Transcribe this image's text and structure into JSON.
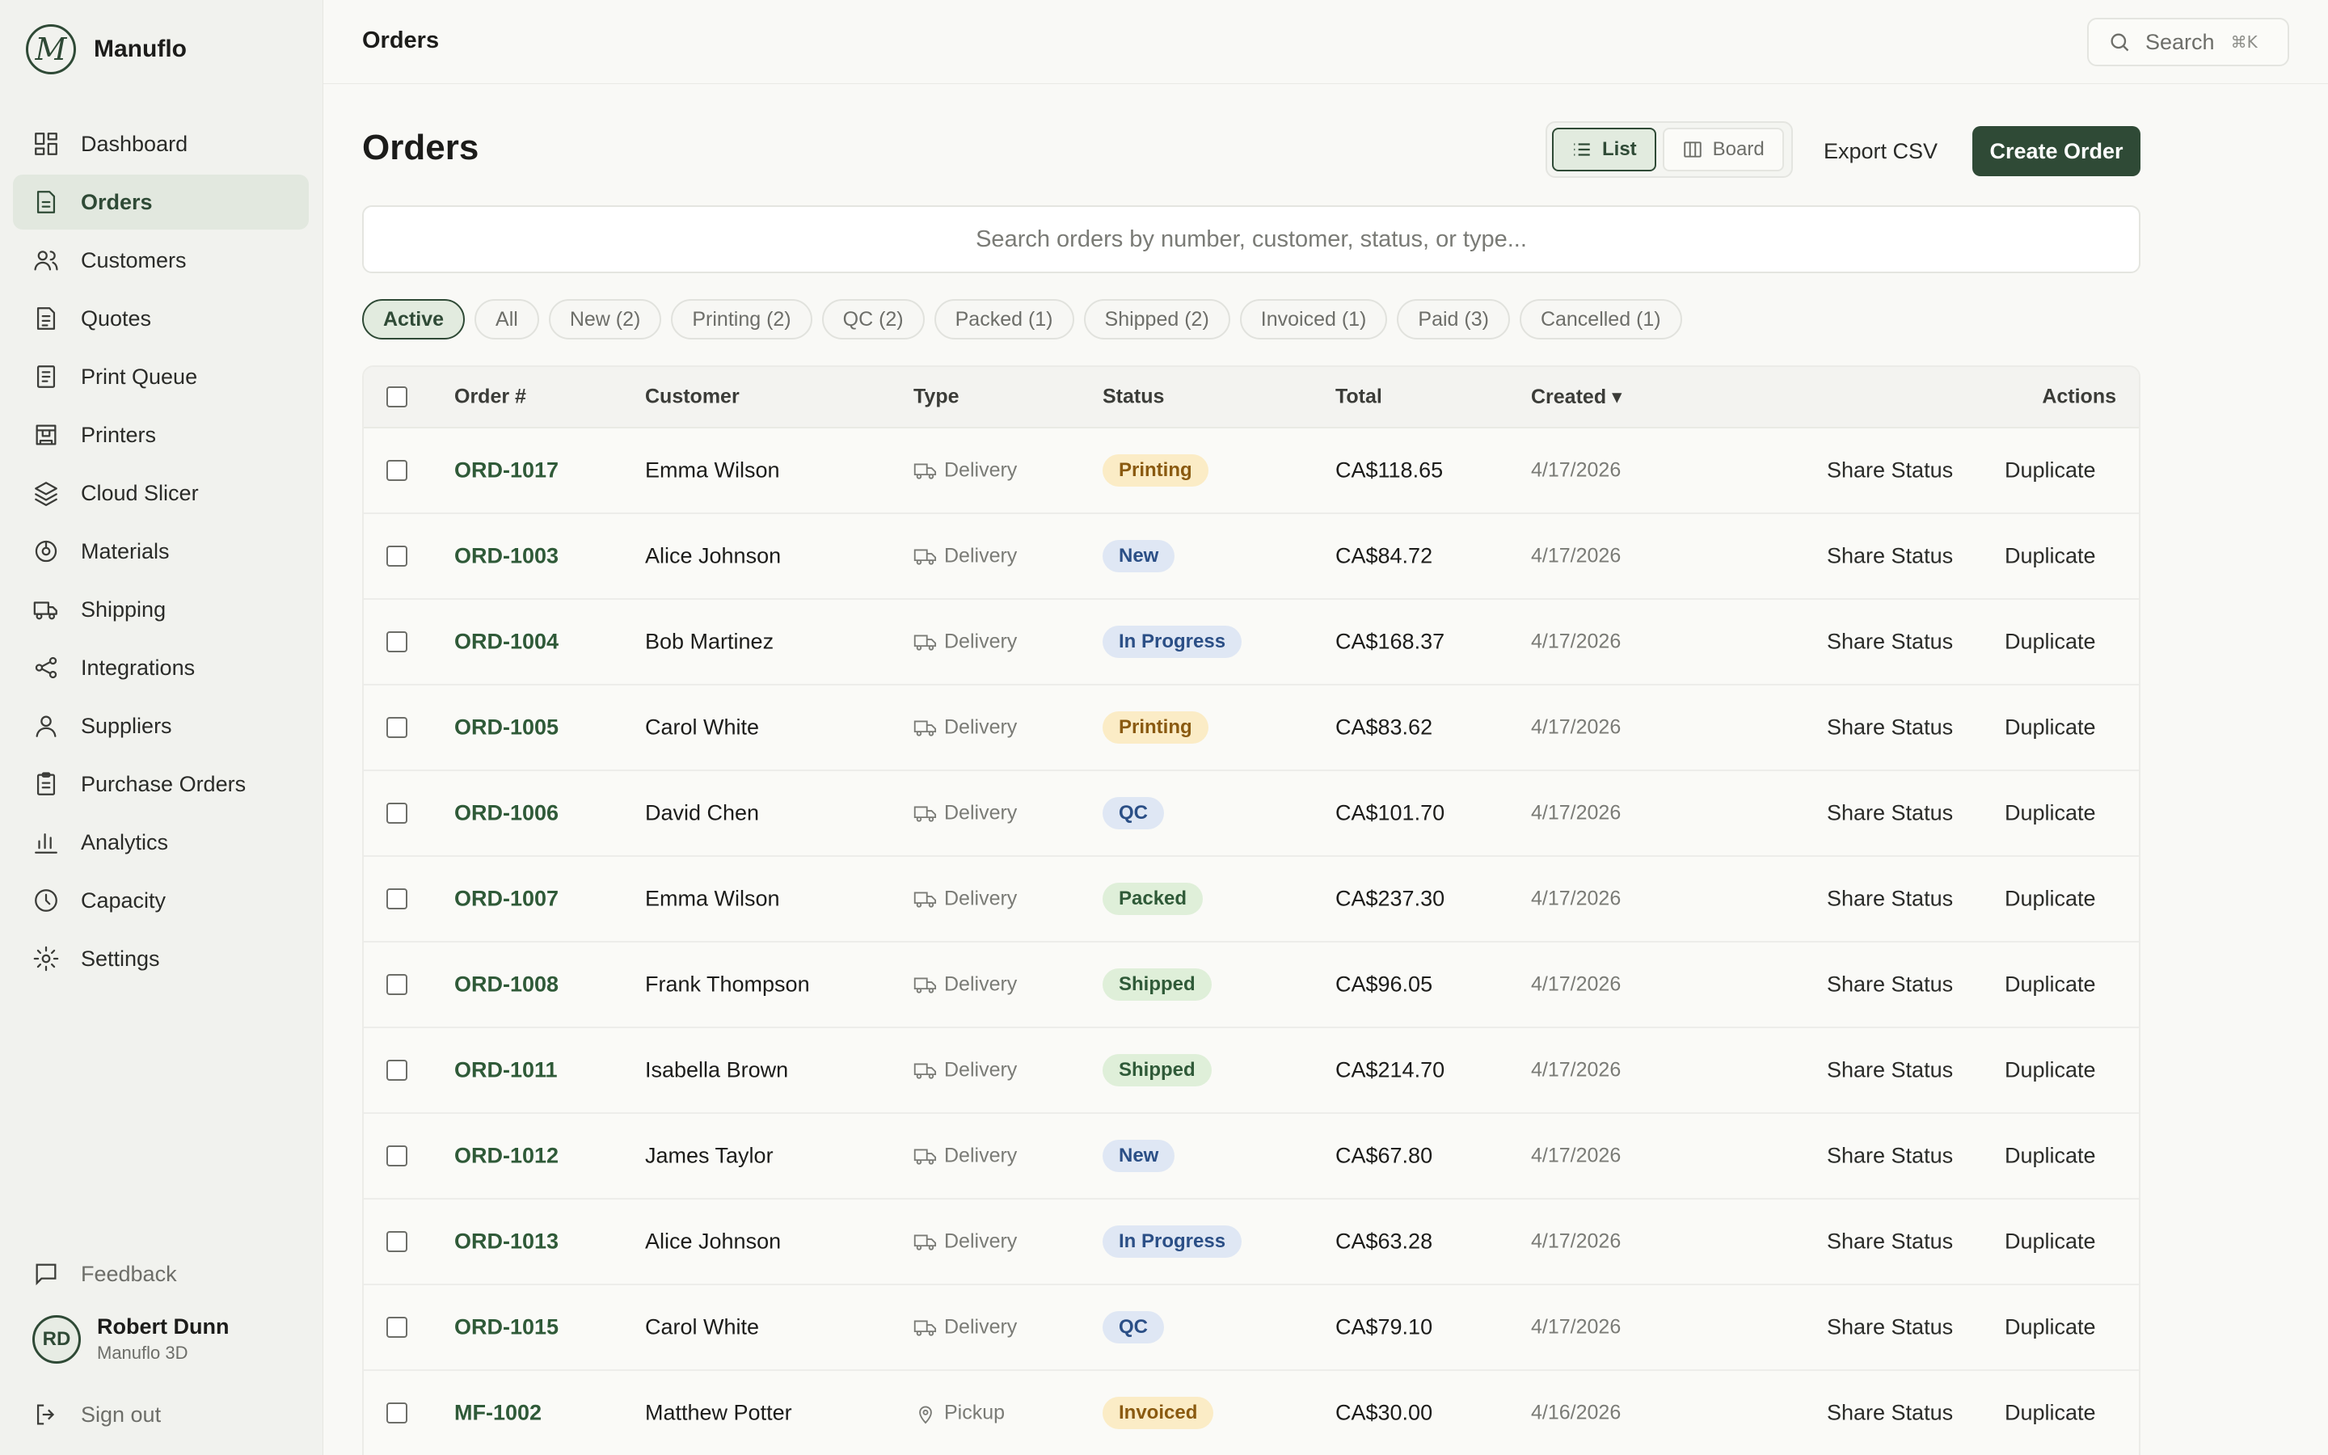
{
  "brand": {
    "logo_letter": "M",
    "name": "Manuflo"
  },
  "sidebar": {
    "items": [
      {
        "label": "Dashboard",
        "icon": "dashboard-icon",
        "active": false
      },
      {
        "label": "Orders",
        "icon": "orders-icon",
        "active": true
      },
      {
        "label": "Customers",
        "icon": "customers-icon",
        "active": false
      },
      {
        "label": "Quotes",
        "icon": "quotes-icon",
        "active": false
      },
      {
        "label": "Print Queue",
        "icon": "print-queue-icon",
        "active": false
      },
      {
        "label": "Printers",
        "icon": "printer-icon",
        "active": false
      },
      {
        "label": "Cloud Slicer",
        "icon": "layers-icon",
        "active": false
      },
      {
        "label": "Materials",
        "icon": "spool-icon",
        "active": false
      },
      {
        "label": "Shipping",
        "icon": "truck-icon",
        "active": false
      },
      {
        "label": "Integrations",
        "icon": "share-nodes-icon",
        "active": false
      },
      {
        "label": "Suppliers",
        "icon": "user-icon",
        "active": false
      },
      {
        "label": "Purchase Orders",
        "icon": "clipboard-icon",
        "active": false
      },
      {
        "label": "Analytics",
        "icon": "bar-chart-icon",
        "active": false
      },
      {
        "label": "Capacity",
        "icon": "clock-icon",
        "active": false
      },
      {
        "label": "Settings",
        "icon": "gear-icon",
        "active": false
      }
    ],
    "feedback_label": "Feedback",
    "signout_label": "Sign out",
    "user": {
      "initials": "RD",
      "name": "Robert Dunn",
      "org": "Manuflo 3D"
    }
  },
  "topbar": {
    "title": "Orders",
    "search_label": "Search",
    "search_shortcut": "⌘K"
  },
  "main": {
    "title": "Orders",
    "view_toggle": {
      "list_label": "List",
      "board_label": "Board",
      "selected": "List"
    },
    "export_label": "Export CSV",
    "create_label": "Create Order",
    "search_placeholder": "Search orders by number, customer, status, or type...",
    "filters": [
      {
        "label": "Active",
        "active": true
      },
      {
        "label": "All",
        "active": false
      },
      {
        "label": "New (2)",
        "active": false
      },
      {
        "label": "Printing (2)",
        "active": false
      },
      {
        "label": "QC (2)",
        "active": false
      },
      {
        "label": "Packed (1)",
        "active": false
      },
      {
        "label": "Shipped (2)",
        "active": false
      },
      {
        "label": "Invoiced (1)",
        "active": false
      },
      {
        "label": "Paid (3)",
        "active": false
      },
      {
        "label": "Cancelled (1)",
        "active": false
      }
    ]
  },
  "table": {
    "columns": {
      "order": "Order #",
      "customer": "Customer",
      "type": "Type",
      "status": "Status",
      "total": "Total",
      "created": "Created ▾",
      "actions": "Actions"
    },
    "action_share": "Share Status",
    "action_duplicate": "Duplicate",
    "rows": [
      {
        "order": "ORD-1017",
        "customer": "Emma Wilson",
        "type": "Delivery",
        "status": "Printing",
        "total": "CA$118.65",
        "created": "4/17/2026"
      },
      {
        "order": "ORD-1003",
        "customer": "Alice Johnson",
        "type": "Delivery",
        "status": "New",
        "total": "CA$84.72",
        "created": "4/17/2026"
      },
      {
        "order": "ORD-1004",
        "customer": "Bob Martinez",
        "type": "Delivery",
        "status": "In Progress",
        "total": "CA$168.37",
        "created": "4/17/2026"
      },
      {
        "order": "ORD-1005",
        "customer": "Carol White",
        "type": "Delivery",
        "status": "Printing",
        "total": "CA$83.62",
        "created": "4/17/2026"
      },
      {
        "order": "ORD-1006",
        "customer": "David Chen",
        "type": "Delivery",
        "status": "QC",
        "total": "CA$101.70",
        "created": "4/17/2026"
      },
      {
        "order": "ORD-1007",
        "customer": "Emma Wilson",
        "type": "Delivery",
        "status": "Packed",
        "total": "CA$237.30",
        "created": "4/17/2026"
      },
      {
        "order": "ORD-1008",
        "customer": "Frank Thompson",
        "type": "Delivery",
        "status": "Shipped",
        "total": "CA$96.05",
        "created": "4/17/2026"
      },
      {
        "order": "ORD-1011",
        "customer": "Isabella Brown",
        "type": "Delivery",
        "status": "Shipped",
        "total": "CA$214.70",
        "created": "4/17/2026"
      },
      {
        "order": "ORD-1012",
        "customer": "James Taylor",
        "type": "Delivery",
        "status": "New",
        "total": "CA$67.80",
        "created": "4/17/2026"
      },
      {
        "order": "ORD-1013",
        "customer": "Alice Johnson",
        "type": "Delivery",
        "status": "In Progress",
        "total": "CA$63.28",
        "created": "4/17/2026"
      },
      {
        "order": "ORD-1015",
        "customer": "Carol White",
        "type": "Delivery",
        "status": "QC",
        "total": "CA$79.10",
        "created": "4/17/2026"
      },
      {
        "order": "MF-1002",
        "customer": "Matthew Potter",
        "type": "Pickup",
        "status": "Invoiced",
        "total": "CA$30.00",
        "created": "4/16/2026"
      }
    ]
  },
  "colors": {
    "accent": "#2f4a36",
    "link": "#2f5a38",
    "background": "#f9f9f6"
  }
}
